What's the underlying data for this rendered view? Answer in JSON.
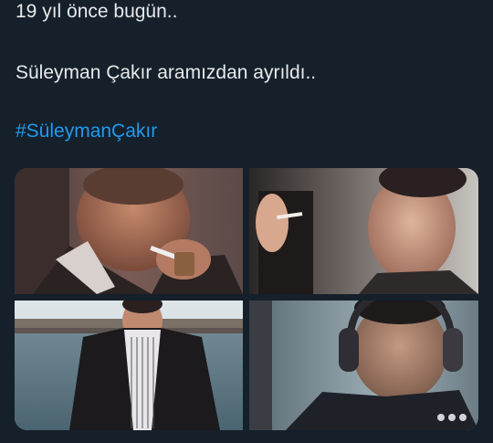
{
  "tweet": {
    "line1": "19 yıl önce bugün..",
    "line2": "Süleyman Çakır aramızdan ayrıldı..",
    "hashtag": "#SüleymanÇakır",
    "hashtag_color": "#1d9bf0",
    "background": "#15202b"
  },
  "media": {
    "photos": [
      {
        "name": "photo-man-lighting-cigarette"
      },
      {
        "name": "photo-man-holding-cigarette"
      },
      {
        "name": "photo-man-by-water"
      },
      {
        "name": "photo-man-with-headphones"
      }
    ]
  }
}
